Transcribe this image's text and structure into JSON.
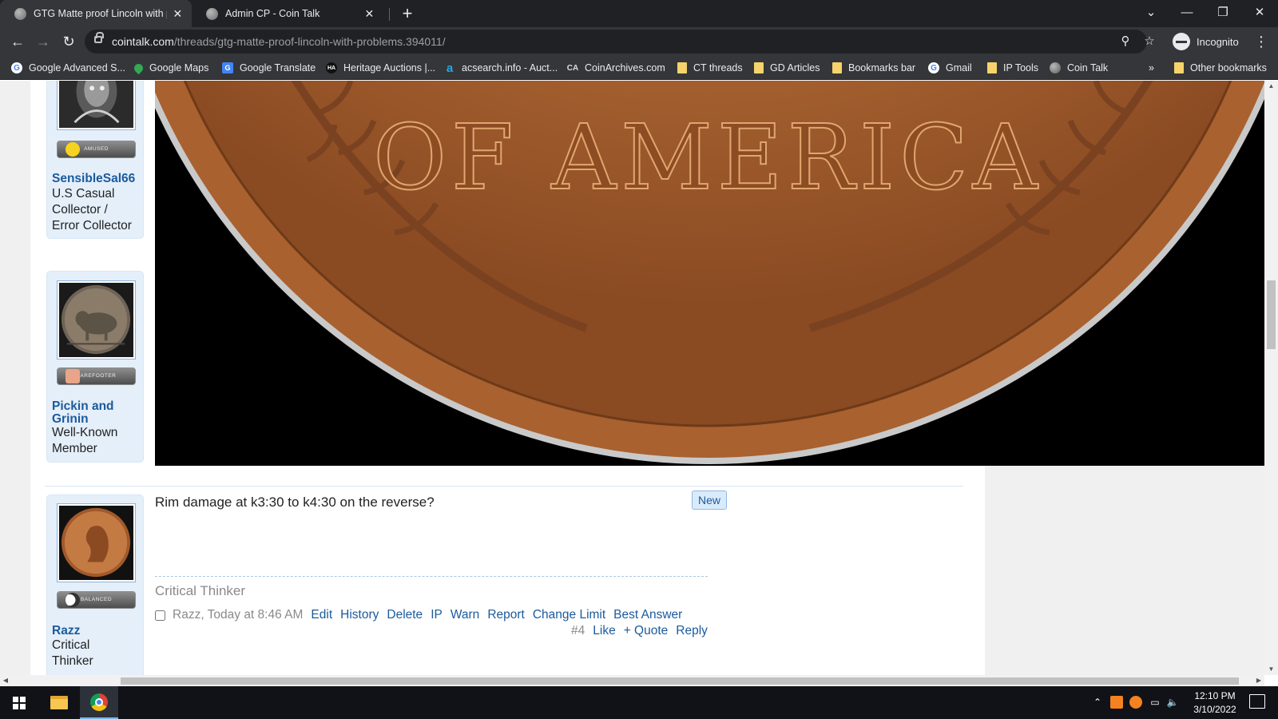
{
  "browser": {
    "tabs": [
      {
        "title": "GTG Matte proof Lincoln with pro",
        "active": true
      },
      {
        "title": "Admin CP - Coin Talk",
        "active": false
      }
    ],
    "url_host": "cointalk.com",
    "url_path": "/threads/gtg-matte-proof-lincoln-with-problems.394011/",
    "profile_label": "Incognito",
    "bookmarks": [
      {
        "label": "Google Advanced S...",
        "icon": "google-icon"
      },
      {
        "label": "Google Maps",
        "icon": "maps-icon"
      },
      {
        "label": "Google Translate",
        "icon": "translate-icon"
      },
      {
        "label": "Heritage Auctions |...",
        "icon": "heritage-icon"
      },
      {
        "label": "acsearch.info - Auct...",
        "icon": "acsearch-icon"
      },
      {
        "label": "CoinArchives.com",
        "icon": "coinarchives-icon"
      },
      {
        "label": "CT threads",
        "icon": "folder-icon"
      },
      {
        "label": "GD Articles",
        "icon": "folder-icon"
      },
      {
        "label": "Bookmarks bar",
        "icon": "folder-icon"
      },
      {
        "label": "Gmail",
        "icon": "google-icon"
      },
      {
        "label": "IP Tools",
        "icon": "folder-icon"
      },
      {
        "label": "Coin Talk",
        "icon": "cointalk-icon"
      }
    ],
    "overflow_label": "»",
    "other_bookmarks": "Other bookmarks"
  },
  "users": [
    {
      "name": "SensibleSal66",
      "title": "U.S Casual Collector / Error Collector",
      "title_lines": [
        "U.S Casual",
        "Collector /",
        "Error Collector"
      ],
      "mood": "AMUSED"
    },
    {
      "name": "Pickin and Grinin",
      "name_lines": [
        "Pickin and",
        "Grinin"
      ],
      "title": "Well-Known Member",
      "title_lines": [
        "Well-Known",
        "Member"
      ],
      "mood": "BAREFOOTER"
    },
    {
      "name": "Razz",
      "title": "Critical Thinker",
      "title_lines": [
        "Critical",
        "Thinker"
      ],
      "mood": "BALANCED"
    }
  ],
  "coin_image": {
    "legend": "OF AMERICA"
  },
  "post": {
    "message": "Rim damage at k3:30 to k4:30 on the reverse?",
    "new_badge": "New",
    "signature": "Critical Thinker",
    "author_time": "Razz, Today at 8:46 AM",
    "admin_links": [
      "Edit",
      "History",
      "Delete",
      "IP",
      "Warn",
      "Report",
      "Change Limit",
      "Best Answer"
    ],
    "number": "#4",
    "actions": [
      "Like",
      "+ Quote",
      "Reply"
    ]
  },
  "taskbar": {
    "time": "12:10 PM",
    "date": "3/10/2022"
  }
}
